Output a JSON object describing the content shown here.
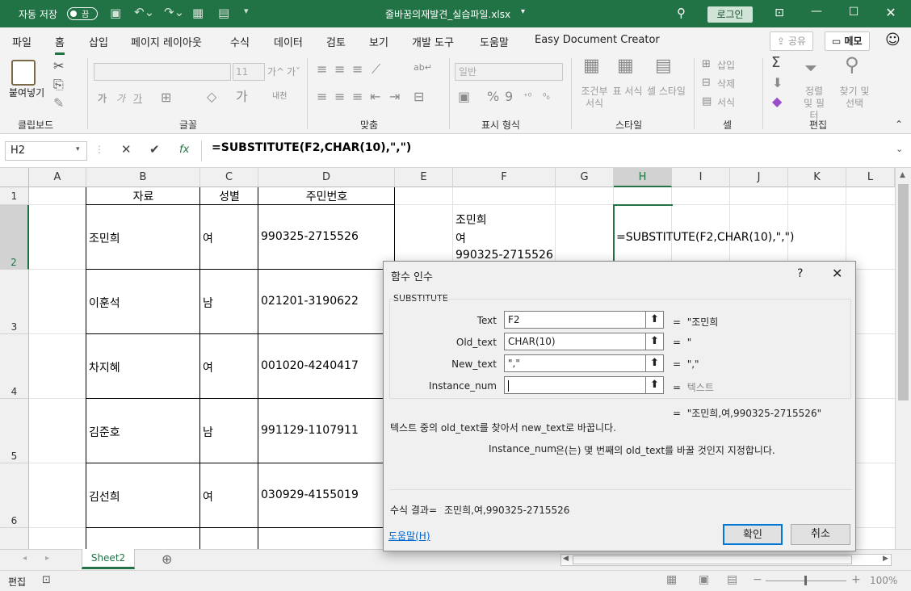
{
  "title_bar": {
    "autosave_label": "자동 저장",
    "autosave_state": "끔",
    "filename": "줄바꿈의재발견_실습파일.xlsx",
    "login_label": "로그인",
    "accent_color": "#217346"
  },
  "menu": {
    "tabs": [
      "파일",
      "홈",
      "삽입",
      "페이지 레이아웃",
      "수식",
      "데이터",
      "검토",
      "보기",
      "개발 도구",
      "도움말",
      "Easy Document Creator"
    ],
    "active": "홈",
    "share_label": "공유",
    "memo_label": "메모"
  },
  "ribbon": {
    "groups": {
      "clipboard": "클립보드",
      "font": "글꼴",
      "align": "맞춤",
      "number": "표시 형식",
      "style": "스타일",
      "cells": "셀",
      "edit": "편집"
    },
    "paste_label": "붙여넣기",
    "font_size": "11",
    "font_a1": "가^",
    "font_a2": "가ˇ",
    "bold": "가",
    "italic": "가",
    "underline": "가",
    "number_format": "일반",
    "cond_format": "조건부 서식",
    "table_format": "표 서식",
    "cell_style": "셀 스타일",
    "insert": "삽입",
    "delete": "삭제",
    "format": "서식",
    "sum": "Σ",
    "sort": "정렬 및 필터",
    "find": "찾기 및 선택"
  },
  "formula_bar": {
    "name_box": "H2",
    "fx": "fx",
    "formula": "=SUBSTITUTE(F2,CHAR(10),\",\")"
  },
  "grid": {
    "columns": [
      "A",
      "B",
      "C",
      "D",
      "E",
      "F",
      "G",
      "H",
      "I",
      "J",
      "K",
      "L"
    ],
    "rows": [
      "1",
      "2",
      "3",
      "4",
      "5",
      "6"
    ],
    "headers": {
      "B": "자료",
      "C": "성별",
      "D": "주민번호"
    },
    "data": [
      {
        "name": "조민희",
        "gender": "여",
        "id": "990325-2715526"
      },
      {
        "name": "이훈석",
        "gender": "남",
        "id": "021201-3190622"
      },
      {
        "name": "차지혜",
        "gender": "여",
        "id": "001020-4240417"
      },
      {
        "name": "김준호",
        "gender": "남",
        "id": "991129-1107911"
      },
      {
        "name": "김선희",
        "gender": "여",
        "id": "030929-4155019"
      }
    ],
    "f2_lines": [
      "조민희",
      "여",
      "990325-2715526"
    ],
    "h2": "=SUBSTITUTE(F2,CHAR(10),\",\")"
  },
  "sheet_tab": "Sheet2",
  "status": {
    "mode": "편집",
    "zoom": "100%"
  },
  "dialog": {
    "title": "함수 인수",
    "help_q": "?",
    "function_name": "SUBSTITUTE",
    "args": [
      {
        "label": "Text",
        "value": "F2",
        "result": "\"조민희"
      },
      {
        "label": "Old_text",
        "value": "CHAR(10)",
        "result": "\""
      },
      {
        "label": "New_text",
        "value": "\",\"",
        "result": "\",\""
      },
      {
        "label": "Instance_num",
        "value": "",
        "result": "텍스트"
      }
    ],
    "overall_result": "\"조민희,여,990325-2715526\"",
    "description": "텍스트 중의 old_text를 찾아서 new_text로 바꿉니다.",
    "arg_help_name": "Instance_num",
    "arg_help_text": "은(는) 몇 번째의 old_text를 바꿀 것인지 지정합니다.",
    "formula_result_label": "수식 결과=",
    "formula_result_value": "조민희,여,990325-2715526",
    "help_link": "도움말(H)",
    "ok_label": "확인",
    "cancel_label": "취소"
  }
}
